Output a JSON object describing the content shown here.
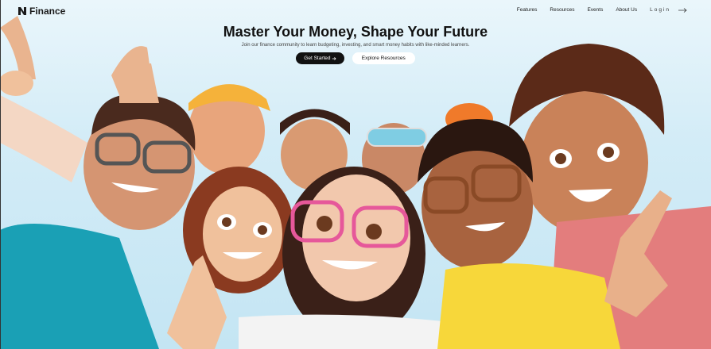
{
  "brand": {
    "name": "Finance"
  },
  "nav": {
    "links": [
      "Features",
      "Resources",
      "Events",
      "About Us"
    ],
    "login": "Login"
  },
  "hero": {
    "title": "Master Your Money, Shape Your Future",
    "subtitle": "Join our finance community to learn budgeting, investing, and smart money habits with like-minded learners.",
    "primary_cta": "Get Started",
    "secondary_cta": "Explore Resources"
  },
  "colors": {
    "sky": "#d3ecf7",
    "primary_button": "#111111"
  }
}
